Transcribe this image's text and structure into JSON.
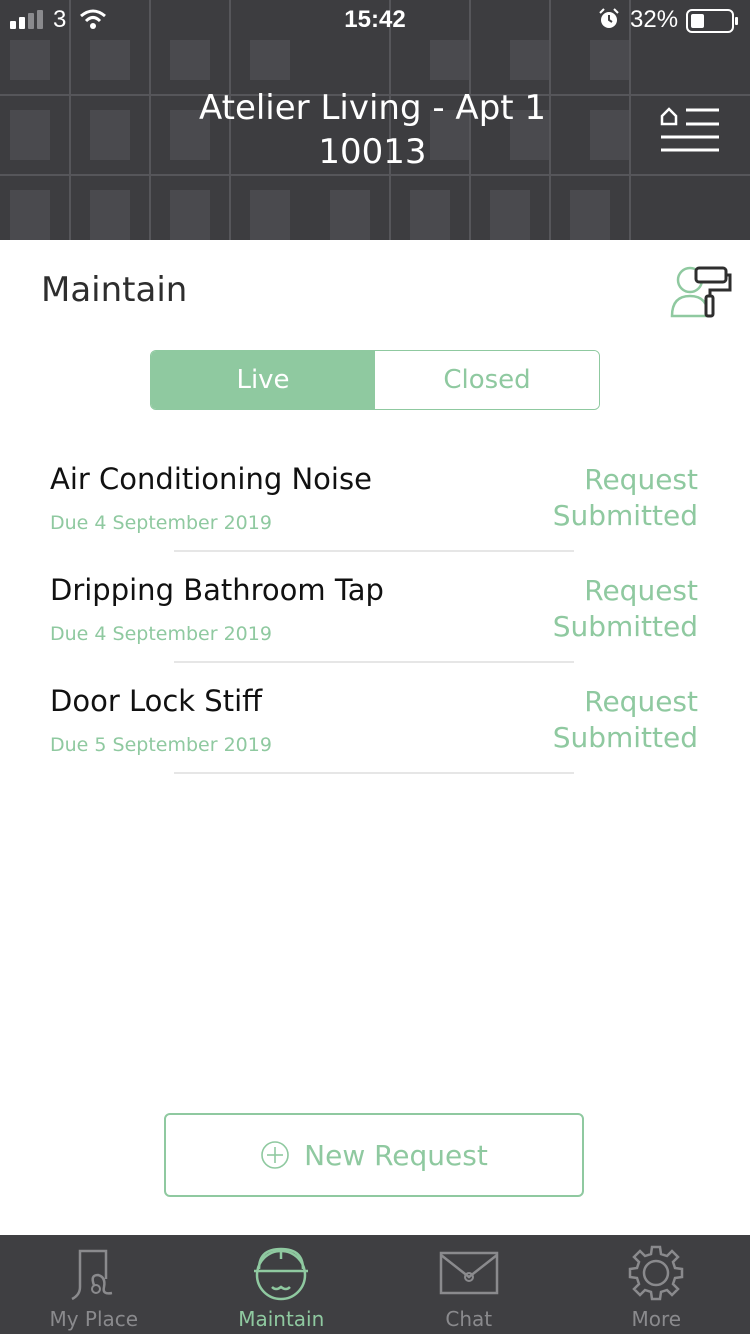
{
  "status_bar": {
    "carrier": "3",
    "time": "15:42",
    "battery": "32%"
  },
  "header": {
    "title": "Atelier Living - Apt 1 10013"
  },
  "page": {
    "title": "Maintain"
  },
  "segments": {
    "live": "Live",
    "closed": "Closed",
    "selected": "Live"
  },
  "requests": [
    {
      "title": "Air Conditioning Noise",
      "due": "Due 4 September 2019",
      "status": "Request Submitted"
    },
    {
      "title": "Dripping Bathroom Tap",
      "due": "Due 4 September 2019",
      "status": "Request Submitted"
    },
    {
      "title": "Door Lock Stiff",
      "due": "Due 5 September 2019",
      "status": "Request Submitted"
    }
  ],
  "new_request": {
    "label": "New Request"
  },
  "tabbar": {
    "items": [
      {
        "label": "My Place",
        "icon": "my-place-icon"
      },
      {
        "label": "Maintain",
        "icon": "hard-hat-icon"
      },
      {
        "label": "Chat",
        "icon": "envelope-icon"
      },
      {
        "label": "More",
        "icon": "gear-icon"
      }
    ],
    "active": "Maintain"
  },
  "colors": {
    "accent": "#8fc9a0",
    "header_bg": "#3f3f42",
    "tabbar_bg": "#3f3f42"
  }
}
